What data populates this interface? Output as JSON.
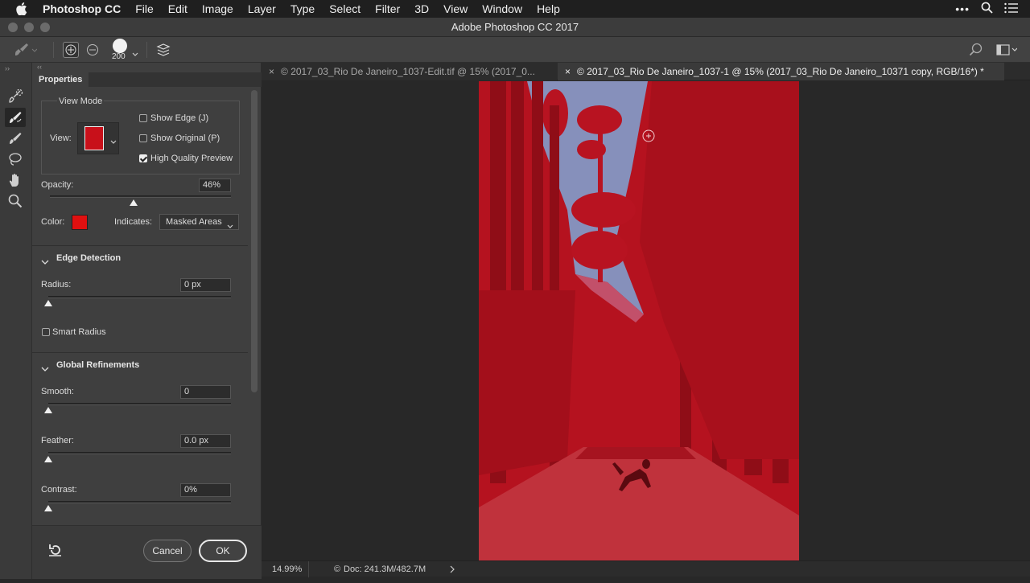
{
  "menubar": {
    "app": "Photoshop CC",
    "items": [
      "File",
      "Edit",
      "Image",
      "Layer",
      "Type",
      "Select",
      "Filter",
      "3D",
      "View",
      "Window",
      "Help"
    ]
  },
  "window": {
    "title": "Adobe Photoshop CC 2017"
  },
  "options": {
    "brush_size": "200"
  },
  "panel": {
    "tab": "Properties",
    "view_mode": {
      "heading": "View Mode",
      "view_label": "View:",
      "show_edge": "Show Edge (J)",
      "show_original": "Show Original (P)",
      "high_quality": "High Quality Preview",
      "show_edge_checked": false,
      "show_original_checked": false,
      "high_quality_checked": true
    },
    "opacity": {
      "label": "Opacity:",
      "value": "46%",
      "level": 0.46
    },
    "color": {
      "label": "Color:",
      "swatch": "#e01010"
    },
    "indicates": {
      "label": "Indicates:",
      "value": "Masked Areas"
    },
    "edge_detection": {
      "heading": "Edge Detection",
      "radius_label": "Radius:",
      "radius_value": "0 px",
      "smart_radius": "Smart Radius",
      "smart_radius_checked": false
    },
    "global_refinements": {
      "heading": "Global Refinements",
      "smooth_label": "Smooth:",
      "smooth_value": "0",
      "feather_label": "Feather:",
      "feather_value": "0.0 px",
      "contrast_label": "Contrast:",
      "contrast_value": "0%"
    },
    "buttons": {
      "cancel": "Cancel",
      "ok": "OK"
    }
  },
  "tabs": [
    {
      "label": "2017_03_Rio De Janeiro_1037-Edit.tif @ 15% (2017_0...",
      "active": false
    },
    {
      "label": "2017_03_Rio De Janeiro_1037-1 @ 15% (2017_03_Rio De Janeiro_10371 copy, RGB/16*) *",
      "active": true
    }
  ],
  "status": {
    "zoom": "14.99%",
    "doc": "Doc: 241.3M/482.7M"
  },
  "colors": {
    "overlay": "#b5121f",
    "sky": "#6aa6d9"
  }
}
